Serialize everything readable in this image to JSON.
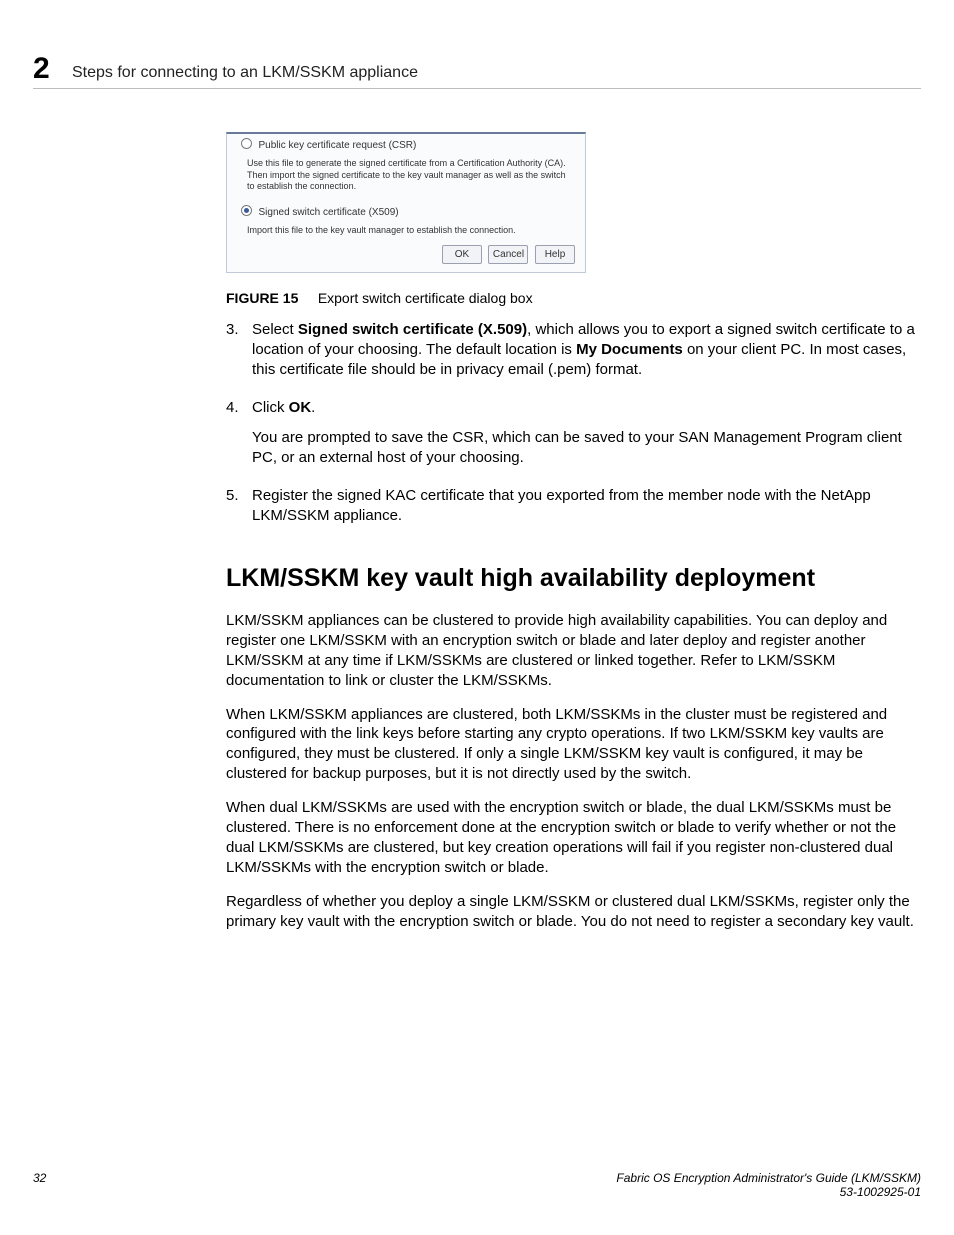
{
  "header": {
    "chapter_number": "2",
    "running_head": "Steps for connecting to an LKM/SSKM appliance"
  },
  "dialog": {
    "opt1_label": "Public key certificate request  (CSR)",
    "opt1_desc": "Use this file to generate the signed certificate from a Certification Authority (CA). Then import the signed certificate to the key vault manager as well as the switch to establish the connection.",
    "opt2_label": "Signed switch certificate  (X509)",
    "opt2_desc": "Import this file to the key vault manager to establish the connection.",
    "btn_ok": "OK",
    "btn_cancel": "Cancel",
    "btn_help": "Help"
  },
  "figure": {
    "label": "FIGURE 15",
    "caption": "Export switch certificate dialog box"
  },
  "steps": {
    "s3_num": "3.",
    "s3a": "Select ",
    "s3b": "Signed switch certificate (X.509)",
    "s3c": ", which allows you to export a signed switch certificate to a location of your choosing. The default location is ",
    "s3d": "My Documents",
    "s3e": " on your client PC. In most cases, this certificate file should be in privacy email (.pem) format.",
    "s4_num": "4.",
    "s4a": "Click ",
    "s4b": "OK",
    "s4c": ".",
    "s4_follow": "You are prompted to save the CSR, which can be saved to your SAN Management Program client PC, or an external host of your choosing.",
    "s5_num": "5.",
    "s5": "Register the signed KAC certificate that you exported from the member node with the NetApp LKM/SSKM appliance."
  },
  "section": {
    "title": "LKM/SSKM key vault high availability deployment",
    "p1": "LKM/SSKM appliances can be clustered to provide high availability capabilities. You can deploy and register one LKM/SSKM with an encryption switch or blade and later deploy and register another LKM/SSKM at any time if LKM/SSKMs are clustered or linked together. Refer to LKM/SSKM documentation to link or cluster the LKM/SSKMs.",
    "p2": "When LKM/SSKM appliances are clustered, both LKM/SSKMs in the cluster must be registered and configured with the link keys before starting any crypto operations. If two LKM/SSKM key vaults are configured, they must be clustered. If only a single LKM/SSKM key vault is configured, it may be clustered for backup purposes, but it is not directly used by the switch.",
    "p3": "When dual LKM/SSKMs are used with the encryption switch or blade, the dual LKM/SSKMs must be clustered. There is no enforcement done at the encryption switch or blade to verify whether or not the dual LKM/SSKMs are clustered, but key creation operations will fail if you register non-clustered dual LKM/SSKMs with the encryption switch or blade.",
    "p4": "Regardless of whether you deploy a single LKM/SSKM or clustered dual LKM/SSKMs, register only the primary key vault with the encryption switch or blade. You do not need to register a secondary key vault."
  },
  "footer": {
    "page": "32",
    "title": "Fabric OS Encryption Administrator's Guide  (LKM/SSKM)",
    "docnum": "53-1002925-01"
  }
}
